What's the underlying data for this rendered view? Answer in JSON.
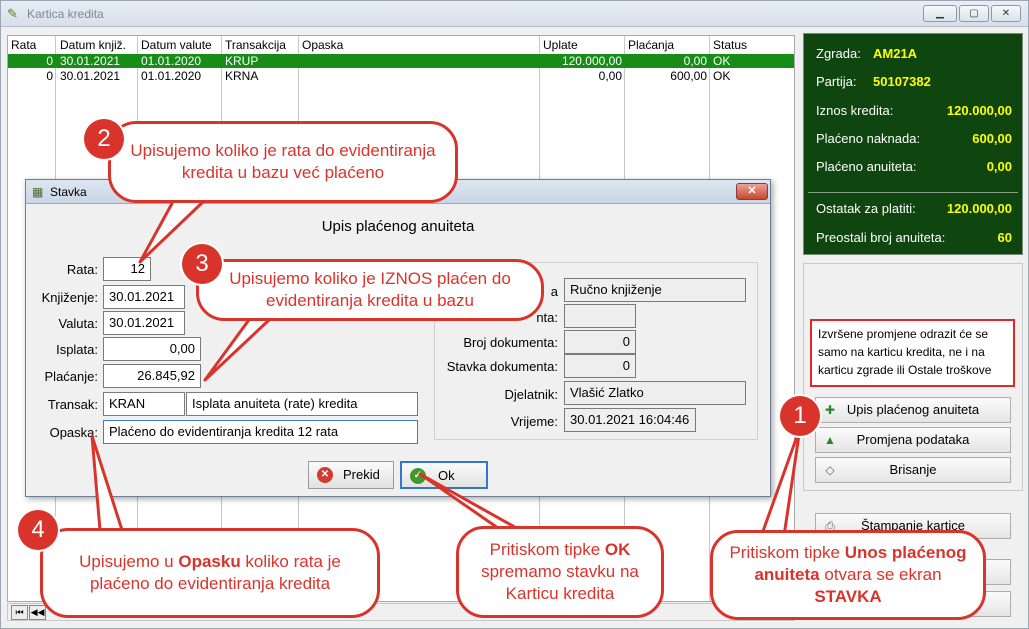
{
  "window": {
    "title": "Kartica kredita",
    "min_label": "▁",
    "max_label": "▢",
    "close_label": "✕"
  },
  "grid": {
    "headers": [
      "Rata",
      "Datum knjiž.",
      "Datum valute",
      "Transakcija",
      "Opaska",
      "Uplate",
      "Plaćanja",
      "Status"
    ],
    "rows": [
      {
        "rata": "0",
        "datum_knjiz": "30.01.2021",
        "datum_valute": "01.01.2020",
        "transakcija": "KRUP",
        "opaska": "",
        "uplate": "120.000,00",
        "placanja": "0,00",
        "status": "OK"
      },
      {
        "rata": "0",
        "datum_knjiz": "30.01.2021",
        "datum_valute": "01.01.2020",
        "transakcija": "KRNA",
        "opaska": "",
        "uplate": "0,00",
        "placanja": "600,00",
        "status": "OK"
      }
    ],
    "nav": [
      "⏮",
      "◀◀"
    ]
  },
  "info": {
    "zgrada_label": "Zgrada:",
    "zgrada": "AM21A",
    "partija_label": "Partija:",
    "partija": "50107382",
    "iznos_label": "Iznos kredita:",
    "iznos": "120.000,00",
    "naknada_label": "Plaćeno naknada:",
    "naknada": "600,00",
    "anuiteta_label": "Plaćeno anuiteta:",
    "anuiteta": "0,00",
    "ostatak_label": "Ostatak za platiti:",
    "ostatak": "120.000,00",
    "preostali_label": "Preostali broj anuiteta:",
    "preostali": "60"
  },
  "notice": "Izvršene promjene odrazit će se samo na karticu kredita, ne i na karticu zgrade ili Ostale troškove",
  "buttons": {
    "upis": "Upis plaćenog anuiteta",
    "promjena": "Promjena podataka",
    "brisanje": "Brisanje",
    "stampanje": "Štampanje kartice"
  },
  "dialog": {
    "title": "Stavka",
    "heading": "Upis plaćenog anuiteta",
    "rata_label": "Rata:",
    "rata": "12",
    "knjizenje_label": "Knjiženje:",
    "knjizenje": "30.01.2021",
    "valuta_label": "Valuta:",
    "valuta": "30.01.2021",
    "isplata_label": "Isplata:",
    "isplata": "0,00",
    "placanje_label": "Plaćanje:",
    "placanje": "26.845,92",
    "transak_label": "Transak:",
    "transak_code": "KRAN",
    "transak_desc": "Isplata anuiteta (rate) kredita",
    "opaska_label": "Opaska:",
    "opaska": "Plaćeno do evidentiranja kredita 12 rata",
    "nacin_label": "a",
    "nacin": "Ručno knjiženje",
    "vezni_label": "nta:",
    "vezni": "",
    "broj_dok_label": "Broj dokumenta:",
    "broj_dok": "0",
    "stavka_dok_label": "Stavka dokumenta:",
    "stavka_dok": "0",
    "djelatnik_label": "Djelatnik:",
    "djelatnik": "Vlašić Zlatko",
    "vrijeme_label": "Vrijeme:",
    "vrijeme": "30.01.2021 16:04:46",
    "prekid_label": "Prekid",
    "ok_label": "Ok"
  },
  "callouts": {
    "c1_num": "1",
    "c1_pre": "Pritiskom tipke ",
    "c1_bold": "Unos plaćenog anuiteta",
    "c1_mid": " otvara se ekran ",
    "c1_bold2": "STAVKA",
    "c2_num": "2",
    "c2": "Upisujemo koliko je rata do evidentiranja kredita u bazu već plaćeno",
    "c3_num": "3",
    "c3": "Upisujemo koliko je IZNOS plaćen do evidentiranja kredita u bazu",
    "c4_num": "4",
    "c4_pre": "Upisujemo u ",
    "c4_bold": "Opasku",
    "c4_post": " koliko rata je plaćeno do evidentiranja kredita",
    "ok_pre": "Pritiskom tipke ",
    "ok_bold": "OK",
    "ok_post": " spremamo stavku na Karticu kredita"
  },
  "colors": {
    "accent_red": "#d9342b",
    "selection_green": "#178c17",
    "info_bg": "#0f460f",
    "info_value": "#ffff00"
  }
}
